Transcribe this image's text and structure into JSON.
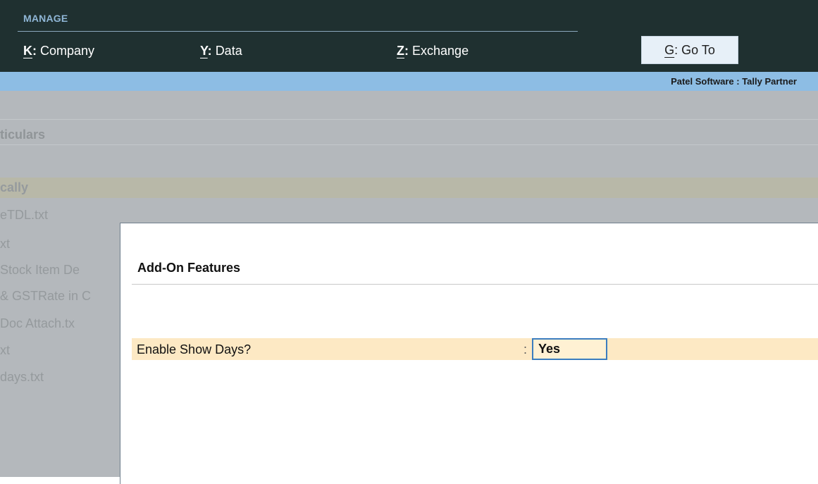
{
  "topbar": {
    "section_label": "MANAGE",
    "menu": [
      {
        "key": "K",
        "label": "Company"
      },
      {
        "key": "Y",
        "label": "Data"
      },
      {
        "key": "Z",
        "label": "Exchange"
      }
    ],
    "goto": {
      "key": "G",
      "label": "Go To"
    }
  },
  "strip": {
    "partner": "Patel Software : Tally Partner"
  },
  "background_list": {
    "header": "ticulars",
    "rows": [
      "cally",
      "eTDL.txt",
      "xt",
      "Stock Item De",
      "& GSTRate in C",
      "Doc Attach.tx",
      "xt",
      "days.txt"
    ]
  },
  "dialog": {
    "title": "Add-On Features",
    "field": {
      "label": "Enable Show Days?",
      "colon": ":",
      "value": "Yes"
    }
  },
  "colors": {
    "topbar_bg": "#1f3030",
    "strip_bg": "#8dbde4",
    "highlight_row": "#fde9c4",
    "focus_border": "#3b7dbf"
  }
}
